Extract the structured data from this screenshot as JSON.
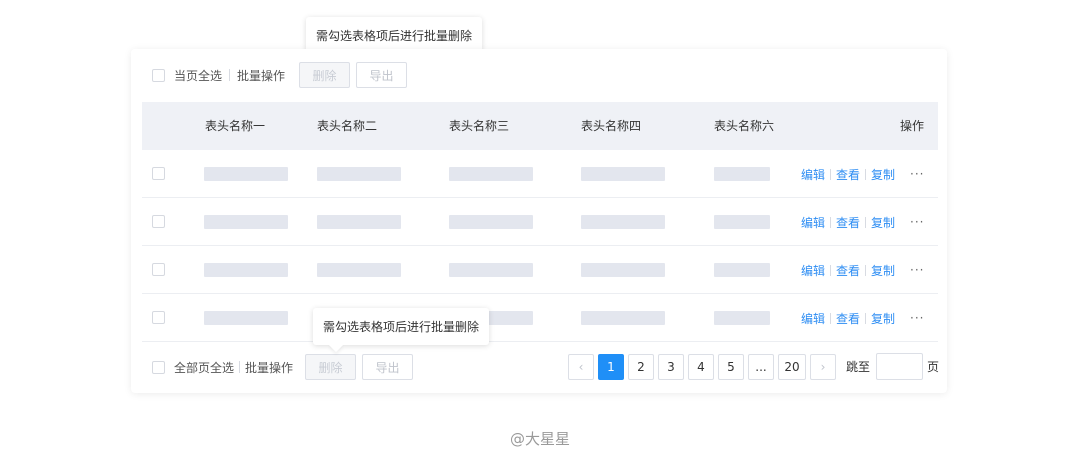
{
  "tooltips": {
    "top": "需勾选表格项后进行批量删除",
    "bottom": "需勾选表格项后进行批量删除"
  },
  "toolbar": {
    "select_page_label": "当页全选",
    "batch_label": "批量操作",
    "delete_label": "删除",
    "export_label": "导出"
  },
  "table": {
    "columns": [
      "表头名称一",
      "表头名称二",
      "表头名称三",
      "表头名称四",
      "表头名称六",
      "操作"
    ],
    "row_count": 4,
    "actions": {
      "edit": "编辑",
      "view": "查看",
      "copy": "复制",
      "more": "···"
    }
  },
  "footer": {
    "select_all_label": "全部页全选",
    "batch_label": "批量操作",
    "delete_label": "删除",
    "export_label": "导出"
  },
  "pagination": {
    "prev": "‹",
    "pages": [
      "1",
      "2",
      "3",
      "4",
      "5",
      "...",
      "20"
    ],
    "current": "1",
    "next": "›",
    "jump_label": "跳至",
    "jump_value": "",
    "page_unit": "页"
  },
  "watermark": "@大星星",
  "colors": {
    "accent": "#1f8ff7",
    "link": "#2f8ef3",
    "header_bg": "#eff1f6",
    "placeholder": "#e3e6ee"
  }
}
